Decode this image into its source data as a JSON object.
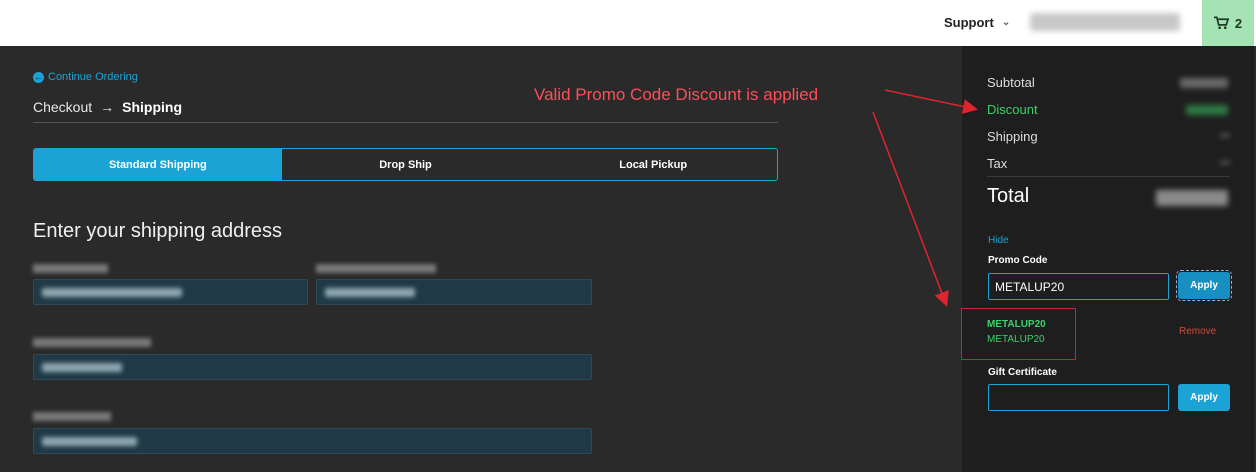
{
  "header": {
    "support_label": "Support",
    "cart_count": "2"
  },
  "nav": {
    "continue_label": "Continue Ordering"
  },
  "breadcrumb": {
    "step1": "Checkout",
    "current": "Shipping"
  },
  "shipping_tabs": [
    {
      "label": "Standard Shipping",
      "active": true
    },
    {
      "label": "Drop Ship",
      "active": false
    },
    {
      "label": "Local Pickup",
      "active": false
    }
  ],
  "address": {
    "title": "Enter your shipping address"
  },
  "summary": {
    "subtotal_label": "Subtotal",
    "discount_label": "Discount",
    "shipping_label": "Shipping",
    "tax_label": "Tax",
    "total_label": "Total"
  },
  "promo": {
    "hide_label": "Hide",
    "label": "Promo Code",
    "value": "METALUP20",
    "apply_label": "Apply",
    "applied_code": "METALUP20",
    "applied_desc": "METALUP20",
    "remove_label": "Remove"
  },
  "gift": {
    "label": "Gift Certificate",
    "value": "",
    "apply_label": "Apply"
  },
  "annotation": {
    "text": "Valid Promo Code Discount is applied"
  },
  "colors": {
    "accent": "#1ba3d6",
    "success": "#3ecf6a",
    "danger": "#d24a3e",
    "annotation": "#ff4d5a",
    "cart_bg": "#a6e3b4"
  }
}
